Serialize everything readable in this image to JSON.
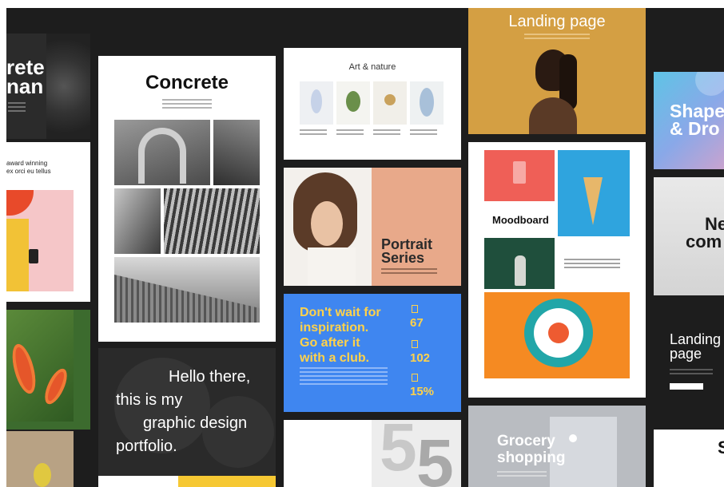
{
  "cards": {
    "concrete_man": {
      "title_line1": "rete",
      "title_line2": "nan"
    },
    "award": {
      "text_line1": "award winning",
      "text_line2": "ex orci eu tellus"
    },
    "concrete": {
      "title": "Concrete"
    },
    "art_nature": {
      "title": "Art & nature"
    },
    "landing_top": {
      "title": "Landing page"
    },
    "shapes": {
      "line1": "Shape",
      "line2": "& Dro"
    },
    "portrait": {
      "line1": "Portrait",
      "line2": "Series"
    },
    "moodboard": {
      "title": "Moodboard"
    },
    "new_comp": {
      "line1": "Ne",
      "line2": "com"
    },
    "club": {
      "headline1": "Don't wait for",
      "headline2": "inspiration.",
      "headline3": "Go after it",
      "headline4": "with a club.",
      "stats": [
        "67",
        "102",
        "15%"
      ]
    },
    "landing_right": {
      "line1": "Landing",
      "line2": "page"
    },
    "hello": {
      "line1": "Hello there,",
      "line2": "this is my",
      "line3": "graphic design",
      "line4": "portfolio."
    },
    "grocery": {
      "line1": "Grocery",
      "line2": "shopping"
    },
    "s_card": {
      "letter": "S"
    },
    "five_card": {
      "glyph": "5"
    }
  },
  "colors": {
    "background": "#1d1d1d",
    "club_blue": "#3f86f0",
    "mustard": "#d49f43",
    "salmon": "#e8a98a",
    "orange": "#f58a22",
    "sky_blue": "#2fa4de",
    "coral": "#ef5f57",
    "forest": "#1f4f3c",
    "leaf_green": "#3c6b2e"
  }
}
